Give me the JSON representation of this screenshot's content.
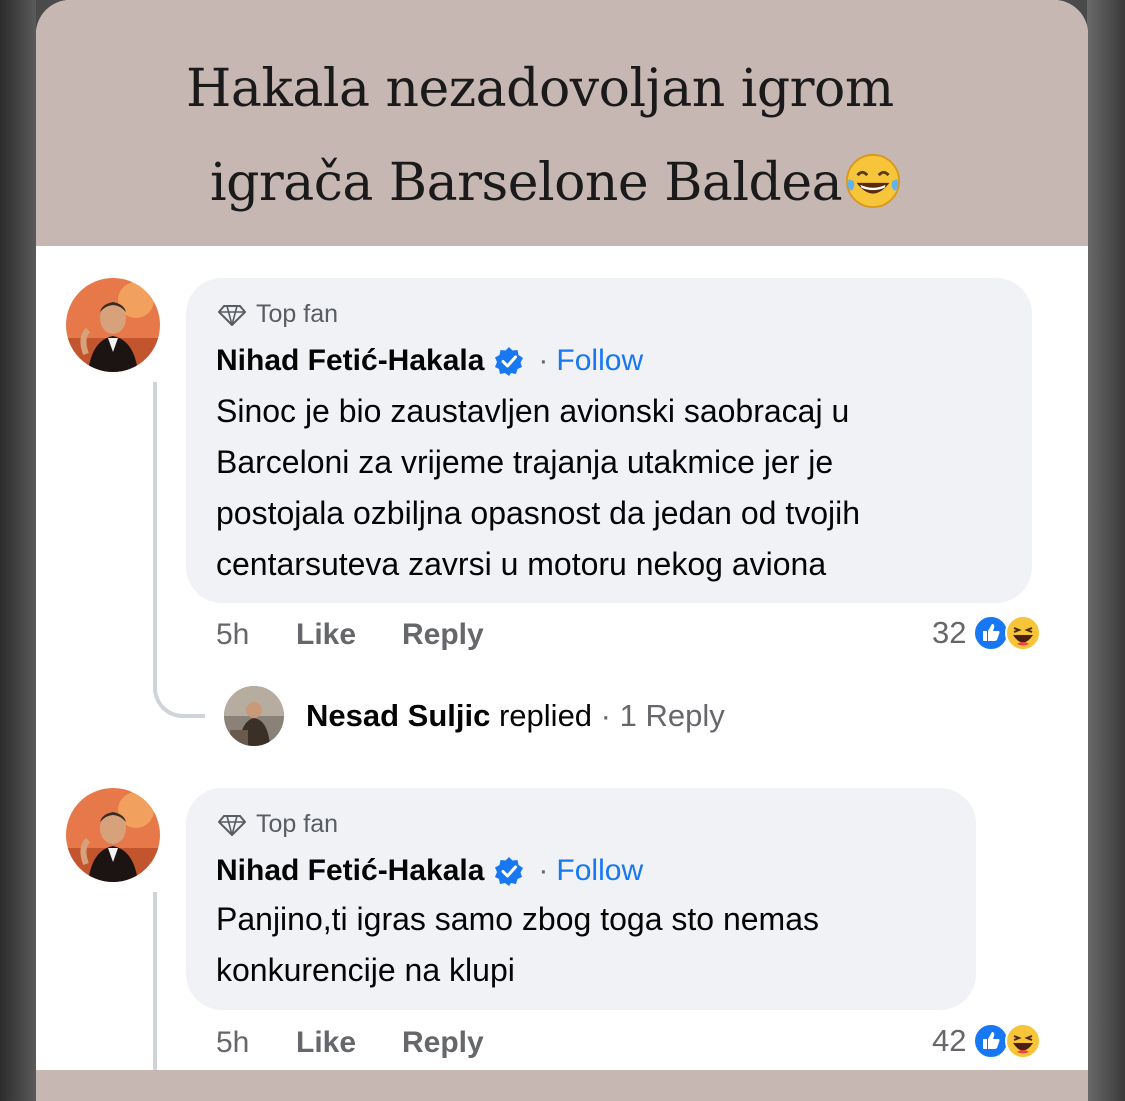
{
  "headline": {
    "line1": "Hakala nezadovoljan igrom",
    "line2": "igrača Barselone Baldea"
  },
  "comments": [
    {
      "badge": "Top fan",
      "author": "Nihad Fetić-Hakala",
      "separator": "·",
      "follow": "Follow",
      "lines": [
        "Sinoc je bio zaustavljen avionski saobracaj u",
        "Barceloni za vrijeme trajanja utakmice jer je",
        "postojala ozbiljna opasnost da jedan od tvojih",
        "centarsuteva zavrsi u motoru nekog aviona"
      ],
      "time": "5h",
      "like": "Like",
      "reply": "Reply",
      "reactions": "32"
    },
    {
      "badge": "Top fan",
      "author": "Nihad Fetić-Hakala",
      "separator": "·",
      "follow": "Follow",
      "lines": [
        "Panjino,ti igras samo zbog toga sto nemas",
        "konkurencije na klupi"
      ],
      "time": "5h",
      "like": "Like",
      "reply": "Reply",
      "reactions": "42"
    }
  ],
  "reply_summary": {
    "name": "Nesad Suljic",
    "action": "replied",
    "count": "· 1 Reply"
  },
  "colors": {
    "header_bg": "#c7b7b3",
    "bubble_bg": "#f0f2f5",
    "link_blue": "#1877f2",
    "muted": "#65676b"
  },
  "icons": [
    "diamond-icon",
    "verified-badge-icon",
    "like-reaction-icon",
    "haha-reaction-icon",
    "laughing-tears-emoji"
  ]
}
